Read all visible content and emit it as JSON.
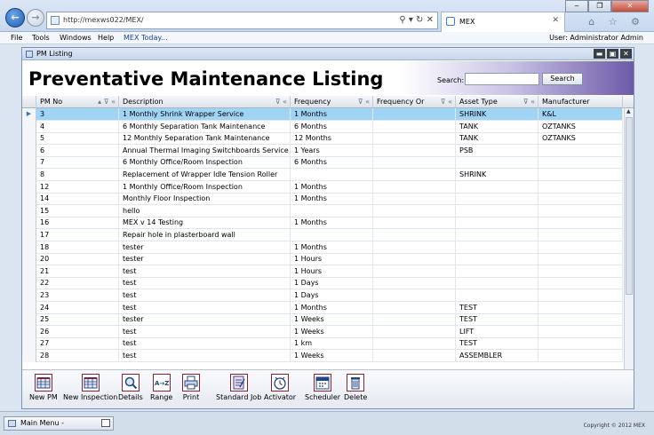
{
  "browser": {
    "url": "http://mexws022/MEX/",
    "tab_title": "MEX",
    "address_icons": "⚲ ▾ ↻ ✕",
    "tab_close": "✕",
    "window_controls": [
      "‒",
      "❐",
      "✕"
    ],
    "chrome_icons": "⌂ ☆ ⚙"
  },
  "menu": {
    "items": [
      "File",
      "Tools",
      "Windows",
      "Help",
      "MEX Today..."
    ],
    "user_label": "User: Administrator Admin"
  },
  "window": {
    "title": "PM Listing",
    "controls": [
      "▬",
      "▣",
      "✕"
    ]
  },
  "header": {
    "title": "Preventative Maintenance Listing",
    "search_label": "Search:",
    "search_value": "",
    "search_button": "Search"
  },
  "grid": {
    "columns": [
      {
        "label": "PM No",
        "controls": "▴ ⊽ «"
      },
      {
        "label": "Description",
        "controls": "⊽ «"
      },
      {
        "label": "Frequency",
        "controls": "⊽ «"
      },
      {
        "label": "Frequency Or",
        "controls": "⊽ «"
      },
      {
        "label": "Asset Type",
        "controls": "⊽ «"
      },
      {
        "label": "Manufacturer",
        "controls": ""
      }
    ],
    "rows": [
      [
        "3",
        "1 Monthly Shrink Wrapper Service",
        "1 Months",
        "",
        "SHRINK",
        "K&L"
      ],
      [
        "4",
        "6 Monthly Separation Tank Maintenance",
        "6 Months",
        "",
        "TANK",
        "OZTANKS"
      ],
      [
        "5",
        "12 Monthly Separation Tank Maintenance",
        "12 Months",
        "",
        "TANK",
        "OZTANKS"
      ],
      [
        "6",
        "Annual Thermal Imaging Switchboards Service",
        "1 Years",
        "",
        "PSB",
        ""
      ],
      [
        "7",
        "6 Monthly Office/Room Inspection",
        "6 Months",
        "",
        "",
        ""
      ],
      [
        "8",
        "Replacement of Wrapper Idle Tension Roller",
        "",
        "",
        "SHRINK",
        ""
      ],
      [
        "12",
        "1 Monthly Office/Room Inspection",
        "1 Months",
        "",
        "",
        ""
      ],
      [
        "14",
        "Monthly Floor Inspection",
        "1 Months",
        "",
        "",
        ""
      ],
      [
        "15",
        "hello",
        "",
        "",
        "",
        ""
      ],
      [
        "16",
        "MEX v 14 Testing",
        "1 Months",
        "",
        "",
        ""
      ],
      [
        "17",
        "Repair hole in plasterboard wall",
        "",
        "",
        "",
        ""
      ],
      [
        "18",
        "tester",
        "1 Months",
        "",
        "",
        ""
      ],
      [
        "20",
        "tester",
        "1 Hours",
        "",
        "",
        ""
      ],
      [
        "21",
        "test",
        "1 Hours",
        "",
        "",
        ""
      ],
      [
        "22",
        "test",
        "1 Days",
        "",
        "",
        ""
      ],
      [
        "23",
        "test",
        "1 Days",
        "",
        "",
        ""
      ],
      [
        "24",
        "test",
        "1 Months",
        "",
        "TEST",
        ""
      ],
      [
        "25",
        "tester",
        "1 Weeks",
        "",
        "TEST",
        ""
      ],
      [
        "26",
        "test",
        "1 Weeks",
        "",
        "LIFT",
        ""
      ],
      [
        "27",
        "test",
        "1 km",
        "",
        "TEST",
        ""
      ],
      [
        "28",
        "test",
        "1 Weeks",
        "",
        "ASSEMBLER",
        ""
      ]
    ],
    "selected_row": 0
  },
  "toolbar": [
    {
      "label": "New PM",
      "icon": "grid-plus-icon"
    },
    {
      "label": "New Inspection",
      "icon": "grid-plus-icon"
    },
    {
      "label": "Details",
      "icon": "magnifier-icon"
    },
    {
      "label": "Range",
      "icon": "a-z-icon"
    },
    {
      "label": "Print",
      "icon": "printer-icon"
    },
    {
      "label": "Standard Job",
      "icon": "document-icon"
    },
    {
      "label": "Activator",
      "icon": "clock-icon"
    },
    {
      "label": "Scheduler",
      "icon": "calendar-icon"
    },
    {
      "label": "Delete",
      "icon": "trash-icon"
    }
  ],
  "taskbar": {
    "main_menu": "Main Menu -",
    "copyright": "Copyright © 2012 MEX"
  },
  "colors": {
    "selected_row": "#9fd4f4",
    "header_gradient_end": "#6c5aa8",
    "toolbar_icon_border": "#8a2036"
  }
}
